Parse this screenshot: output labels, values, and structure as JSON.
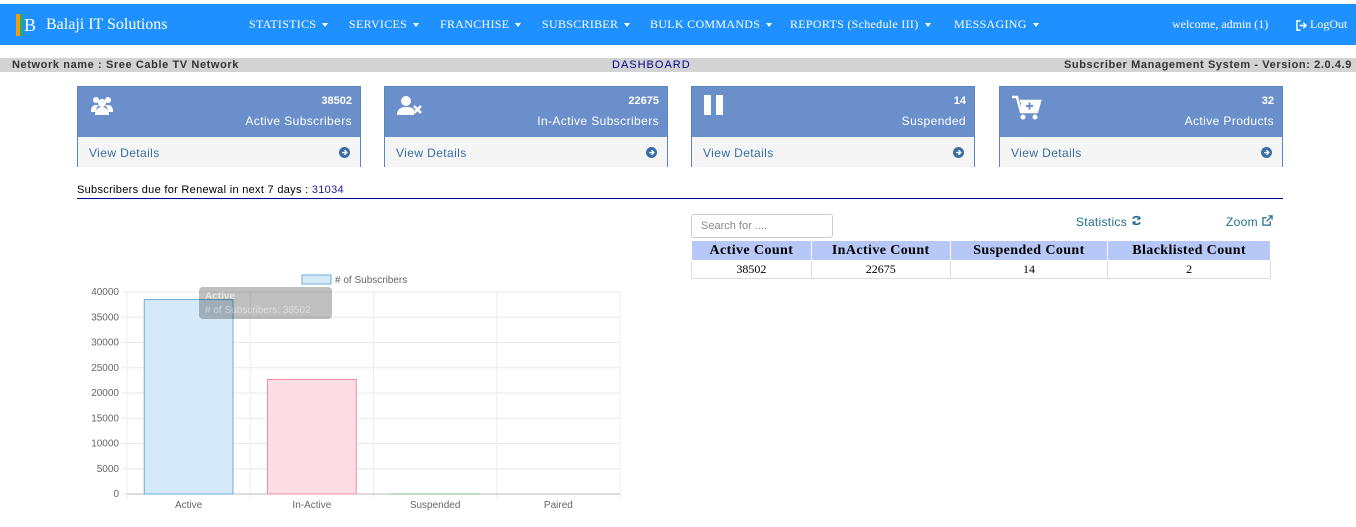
{
  "brand": {
    "name": "Balaji IT Solutions",
    "logo_letter": "B"
  },
  "nav": {
    "items": [
      {
        "label": "STATISTICS",
        "name": "nav-statistics"
      },
      {
        "label": "SERVICES",
        "name": "nav-services"
      },
      {
        "label": "FRANCHISE",
        "name": "nav-franchise"
      },
      {
        "label": "SUBSCRIBER",
        "name": "nav-subscriber"
      },
      {
        "label": "BULK COMMANDS",
        "name": "nav-bulk-commands"
      },
      {
        "label": "REPORTS (Schedule III)",
        "name": "nav-reports"
      },
      {
        "label": "MESSAGING",
        "name": "nav-messaging"
      }
    ],
    "welcome": "welcome, admin (1)",
    "logout": "LogOut"
  },
  "infobar": {
    "network": "Network name : Sree Cable TV Network",
    "dashboard": "DASHBOARD",
    "version": "Subscriber Management System - Version: 2.0.4.9"
  },
  "cards": [
    {
      "value": "38502",
      "label": "Active Subscribers",
      "icon": "users-icon",
      "link": "View Details"
    },
    {
      "value": "22675",
      "label": "In-Active Subscribers",
      "icon": "user-times-icon",
      "link": "View Details"
    },
    {
      "value": "14",
      "label": "Suspended",
      "icon": "pause-icon",
      "link": "View Details"
    },
    {
      "value": "32",
      "label": "Active Products",
      "icon": "cart-plus-icon",
      "link": "View Details"
    }
  ],
  "renewal": {
    "text": "Subscribers due for Renewal in next 7 days :",
    "value": "31034"
  },
  "search": {
    "placeholder": "Search for ...."
  },
  "links": {
    "statistics": "Statistics",
    "zoom": "Zoom"
  },
  "table": {
    "headers": [
      "Active Count",
      "InActive Count",
      "Suspended Count",
      "Blacklisted Count"
    ],
    "rows": [
      [
        "38502",
        "22675",
        "14",
        "2"
      ]
    ]
  },
  "colors": {
    "navbar": "#1e90ff",
    "card_head": "#6a8fcb",
    "bar_active": "#d6e9f8",
    "bar_inactive": "#ffdde4"
  },
  "chart_data": {
    "type": "bar",
    "categories": [
      "Active",
      "In-Active",
      "Suspended",
      "Paired"
    ],
    "series": [
      {
        "name": "# of Subscribers",
        "values": [
          38502,
          22675,
          14,
          0
        ]
      }
    ],
    "ylim": [
      0,
      40000
    ],
    "yticks": [
      0,
      5000,
      10000,
      15000,
      20000,
      25000,
      30000,
      35000,
      40000
    ],
    "legend": "top",
    "grid": true,
    "tooltip": {
      "title": "Active",
      "text": "# of Subscribers: 38502"
    }
  }
}
